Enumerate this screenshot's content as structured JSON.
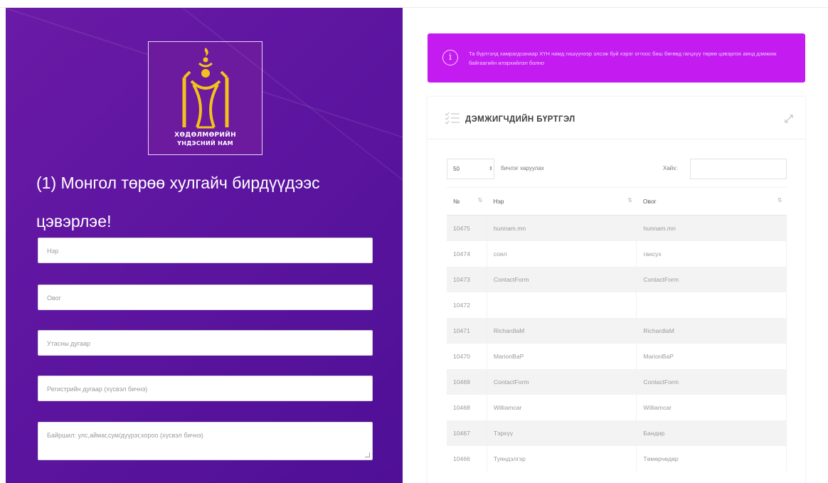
{
  "party_logo": {
    "line1": "ХӨДӨЛМӨРИЙН",
    "line2": "ҮНДЭСНИЙ НАМ"
  },
  "slogan": "(1) Монгол төрөө хулгайч бирдүүдээс цэвэрлэе!",
  "form": {
    "name_placeholder": "Нэр",
    "ovog_placeholder": "Овог",
    "phone_placeholder": "Утасны дугаар",
    "register_placeholder": "Регистрийн дугаар (хүсвэл бичнэ)",
    "address_placeholder": "Байршил: улс,аймаг,сум/дүүрэг,хороо (хүсвэл бичнэ)"
  },
  "alert": {
    "text": "Та бүртгэлд хамрагдсанаар ХҮН намд гишүүнээр элсэж буй хэрэг огтоос биш бөгөөд гагцхүү төрөө цэвэрлэх аянд дэмжиж байгаагийн илэрхийлэл болно"
  },
  "card": {
    "title": "ДЭМЖИГЧДИЙН БҮРТГЭЛ",
    "page_length": "50",
    "page_length_label": "бичлэг харуулах",
    "search_label": "Хайх:"
  },
  "table": {
    "columns": [
      "№",
      "Нэр",
      "Овог"
    ],
    "rows": [
      {
        "id": "10475",
        "name": "hunnam.mn",
        "ovog": "hunnam.mn"
      },
      {
        "id": "10474",
        "name": "соел",
        "ovog": "гансух"
      },
      {
        "id": "10473",
        "name": "ContactForm",
        "ovog": "ContactForm"
      },
      {
        "id": "10472",
        "name": "",
        "ovog": ""
      },
      {
        "id": "10471",
        "name": "RichardlaM",
        "ovog": "RichardlaM"
      },
      {
        "id": "10470",
        "name": "MarionBaP",
        "ovog": "MarionBaP"
      },
      {
        "id": "10469",
        "name": "ContactForm",
        "ovog": "ContactForm"
      },
      {
        "id": "10468",
        "name": "Williamcar",
        "ovog": "Williamcar"
      },
      {
        "id": "10467",
        "name": "Тэрхүү",
        "ovog": "Бандир"
      },
      {
        "id": "10466",
        "name": "Туяндэлгэр",
        "ovog": "Төмөрчөдөр"
      }
    ]
  },
  "colors": {
    "left_panel": "#5d15a0",
    "alert": "#c41bf0",
    "logo_gold": "#f2c21b"
  }
}
